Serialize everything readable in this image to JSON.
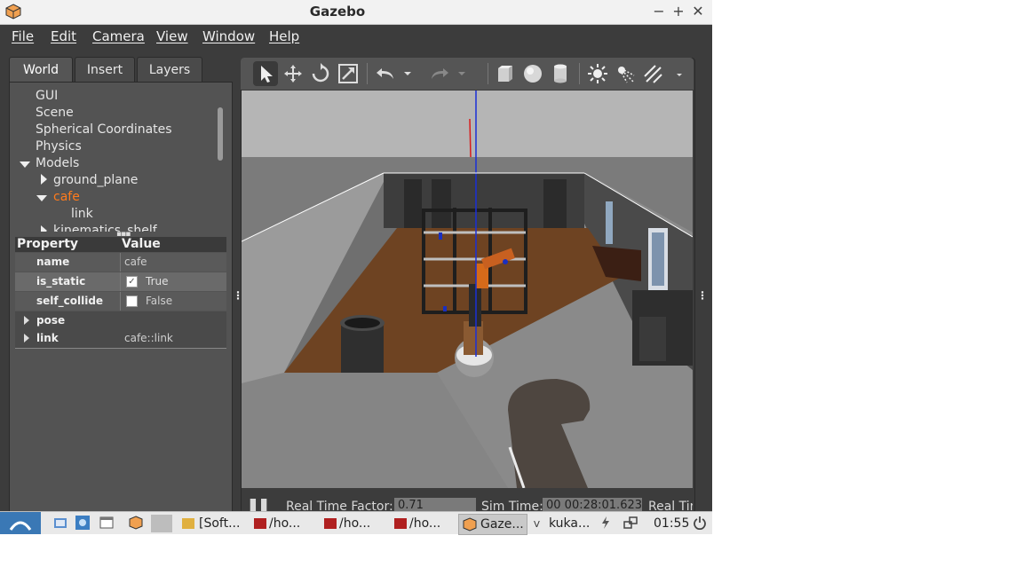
{
  "window": {
    "title": "Gazebo"
  },
  "menubar": [
    "File",
    "Edit",
    "Camera",
    "View",
    "Window",
    "Help"
  ],
  "left_tabs": [
    "World",
    "Insert",
    "Layers"
  ],
  "tree": {
    "items": [
      {
        "label": "GUI"
      },
      {
        "label": "Scene"
      },
      {
        "label": "Spherical Coordinates"
      },
      {
        "label": "Physics"
      },
      {
        "label": "Models"
      },
      {
        "label": "ground_plane"
      },
      {
        "label": "cafe"
      },
      {
        "label": "link"
      },
      {
        "label": "kinematics_shelf"
      }
    ]
  },
  "properties": {
    "header_property": "Property",
    "header_value": "Value",
    "rows": [
      {
        "key": "name",
        "value": "cafe"
      },
      {
        "key": "is_static",
        "value": "True"
      },
      {
        "key": "self_collide",
        "value": "False"
      },
      {
        "key": "pose",
        "value": ""
      },
      {
        "key": "link",
        "value": "cafe::link"
      }
    ]
  },
  "toolbar_icons": [
    "select-arrow-icon",
    "translate-icon",
    "rotate-icon",
    "scale-icon",
    "undo-icon",
    "redo-icon",
    "box-icon",
    "sphere-icon",
    "cylinder-icon",
    "sun-light-icon",
    "spot-light-icon",
    "directional-light-icon"
  ],
  "status": {
    "real_time_factor_label": "Real Time Factor:",
    "real_time_factor": "0.71",
    "sim_time_label": "Sim Time:",
    "sim_time": "00 00:28:01.623",
    "real_time_label": "Real Tir"
  },
  "taskbar": {
    "items": [
      "[Soft...",
      "/ho...",
      "/ho...",
      "/ho...",
      "Gaze...",
      "kuka..."
    ],
    "clock": "01:55"
  },
  "colors": {
    "selected": "#ff7b1c",
    "panel": "#535353",
    "window": "#3c3c3c"
  }
}
